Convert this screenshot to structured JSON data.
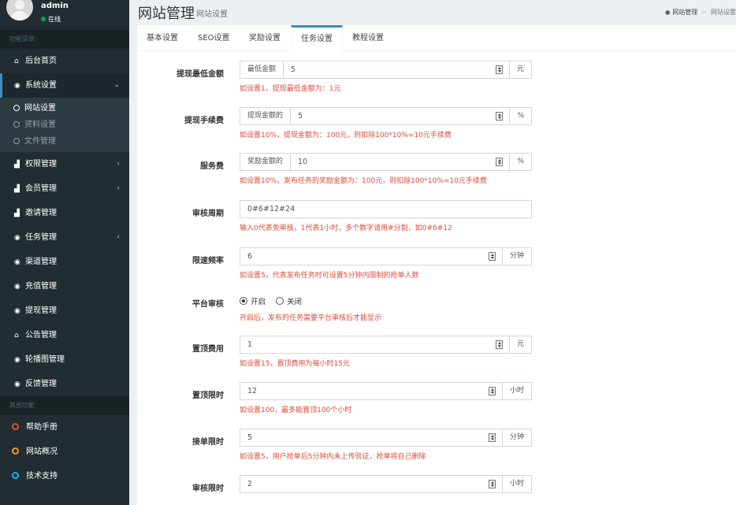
{
  "user": {
    "name": "admin",
    "status": "在线"
  },
  "sidebar": {
    "header_main": "功能菜单",
    "items": [
      {
        "label": "后台首页",
        "icon": "home-icon",
        "glyph": "⌂"
      },
      {
        "label": "系统设置",
        "icon": "dashboard-icon",
        "glyph": "◉"
      }
    ],
    "submenu": [
      {
        "label": "网站设置"
      },
      {
        "label": "资料设置"
      },
      {
        "label": "文件管理"
      }
    ],
    "items2": [
      {
        "label": "权限管理",
        "icon": "users-icon",
        "glyph": "▟"
      },
      {
        "label": "会员管理",
        "icon": "users-icon",
        "glyph": "▟"
      },
      {
        "label": "邀请管理",
        "icon": "users-icon",
        "glyph": "▟"
      },
      {
        "label": "任务管理",
        "icon": "dashboard-icon",
        "glyph": "◉"
      },
      {
        "label": "渠道管理",
        "icon": "dashboard-icon",
        "glyph": "◉"
      },
      {
        "label": "充值管理",
        "icon": "dashboard-icon",
        "glyph": "◉"
      },
      {
        "label": "提现管理",
        "icon": "dashboard-icon",
        "glyph": "◉"
      },
      {
        "label": "公告管理",
        "icon": "home-icon",
        "glyph": "⌂"
      },
      {
        "label": "轮播图管理",
        "icon": "dashboard-icon",
        "glyph": "◉"
      },
      {
        "label": "反馈管理",
        "icon": "dashboard-icon",
        "glyph": "◉"
      }
    ],
    "header_other": "其他功能",
    "other": [
      {
        "label": "帮助手册",
        "color": "#dd4b39"
      },
      {
        "label": "网站概况",
        "color": "#f39c12"
      },
      {
        "label": "技术支持",
        "color": "#00c0ef"
      }
    ]
  },
  "header": {
    "title": "网站管理",
    "subtitle": "网站设置",
    "breadcrumb": [
      "网站管理",
      "网站设置"
    ]
  },
  "tabs": [
    "基本设置",
    "SEO设置",
    "奖励设置",
    "任务设置",
    "教程设置"
  ],
  "form": {
    "withdraw_min": {
      "label": "提现最低金额",
      "prefix": "最低金额",
      "value": "5",
      "unit": "元",
      "help": "如设置1，提现最低金额为：1元"
    },
    "withdraw_fee": {
      "label": "提现手续费",
      "prefix": "提现金额的",
      "value": "5",
      "unit": "%",
      "help": "如设置10%，提现金额为：100元，则扣除100*10%=10元手续费"
    },
    "service_fee": {
      "label": "服务费",
      "prefix": "奖励金额的",
      "value": "10",
      "unit": "%",
      "help": "如设置10%，发布任务的奖励金额为：100元，则扣除100*10%=10元手续费"
    },
    "review_period": {
      "label": "审核周期",
      "value": "0#6#12#24",
      "help": "输入0代表免审核，1代表1小时，多个数字请用#分割，如0#6#12"
    },
    "rate_limit": {
      "label": "限速频率",
      "value": "6",
      "unit": "分钟",
      "help": "如设置5，代表发布任务时可设置5分钟内限制的抢单人数"
    },
    "platform_review": {
      "label": "平台审核",
      "option_on": "开启",
      "option_off": "关闭",
      "help": "开启后，发布的任务需要平台审核后才能显示"
    },
    "top_fee": {
      "label": "置顶费用",
      "value": "1",
      "unit": "元",
      "help": "如设置15，置顶费用为每小时15元"
    },
    "top_limit": {
      "label": "置顶限时",
      "value": "12",
      "unit": "小时",
      "help": "如设置100，最多能置顶100个小时"
    },
    "accept_limit": {
      "label": "接单限时",
      "value": "5",
      "unit": "分钟",
      "help": "如设置5，用户抢单后5分钟内未上传验证，抢单将自己删除"
    },
    "review_limit": {
      "label": "审核限时",
      "value": "2",
      "unit": "小时"
    }
  }
}
